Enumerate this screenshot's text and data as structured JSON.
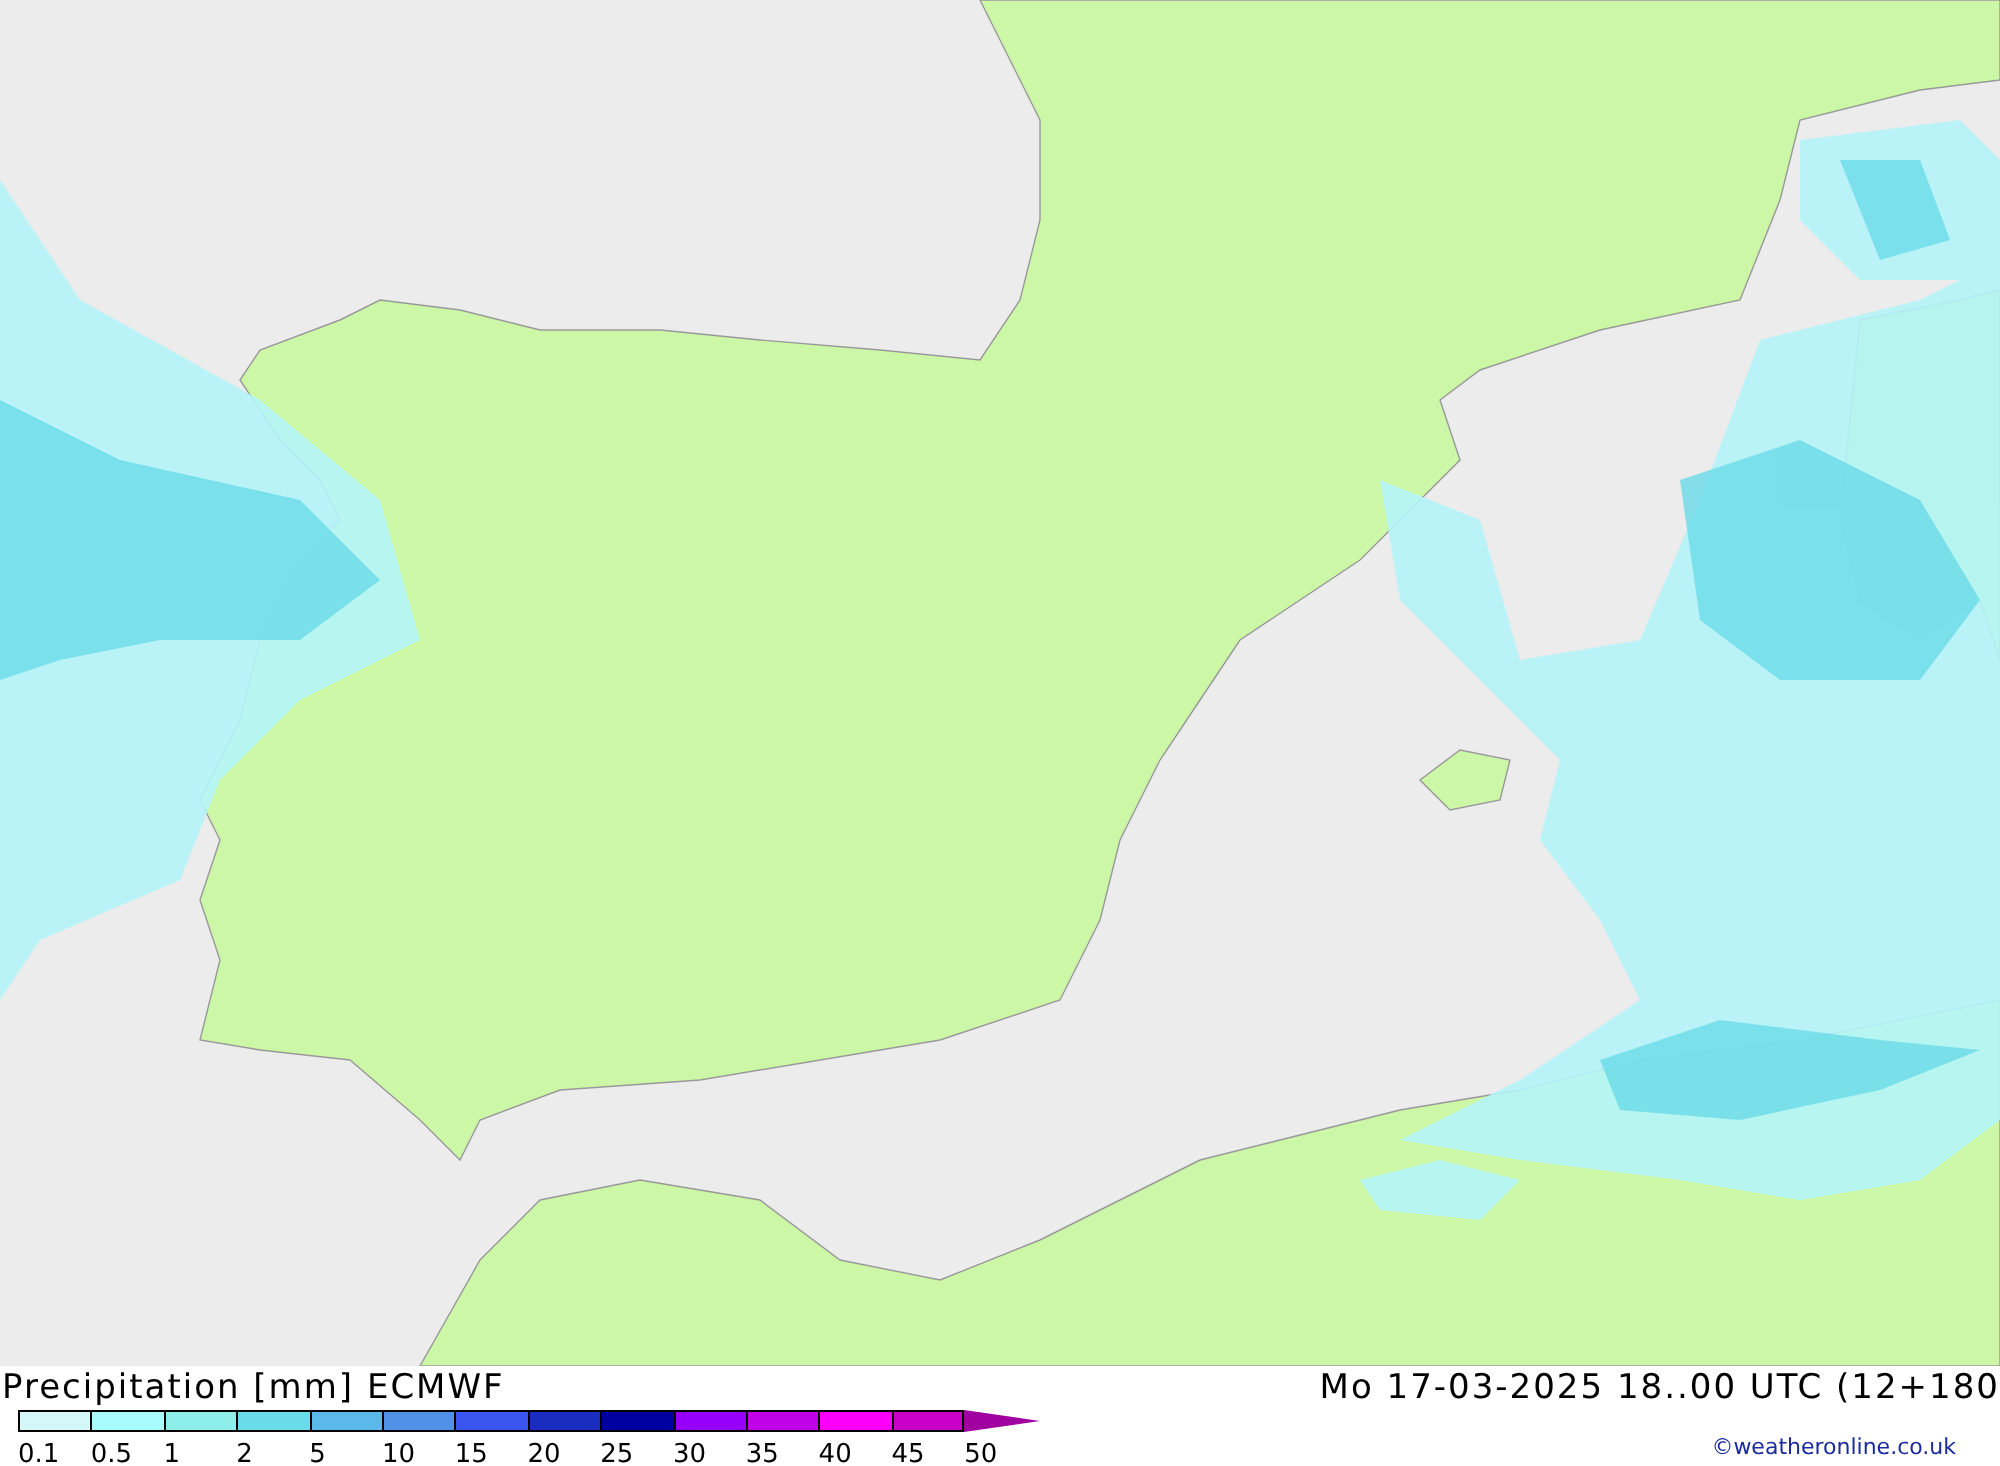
{
  "map": {
    "title": "Precipitation [mm] ECMWF",
    "valid_time": "Mo 17-03-2025 18..00 UTC (12+180"
  },
  "legend": {
    "swatches": [
      {
        "color": "#d4f7f7",
        "label": "0.1"
      },
      {
        "color": "#a8fcfc",
        "label": "0.5"
      },
      {
        "color": "#8eeeea",
        "label": "1"
      },
      {
        "color": "#6adbe9",
        "label": "2"
      },
      {
        "color": "#5bb9e9",
        "label": "5"
      },
      {
        "color": "#5090e6",
        "label": "10"
      },
      {
        "color": "#3b55f0",
        "label": "15"
      },
      {
        "color": "#1a2dc0",
        "label": "20"
      },
      {
        "color": "#0000a0",
        "label": "25"
      },
      {
        "color": "#9600fa",
        "label": "30"
      },
      {
        "color": "#c000e6",
        "label": "35"
      },
      {
        "color": "#fa00fa",
        "label": "40"
      },
      {
        "color": "#c800c8",
        "label": "45"
      }
    ],
    "last_label": "50"
  },
  "copyright": "©weatheronline.co.uk"
}
